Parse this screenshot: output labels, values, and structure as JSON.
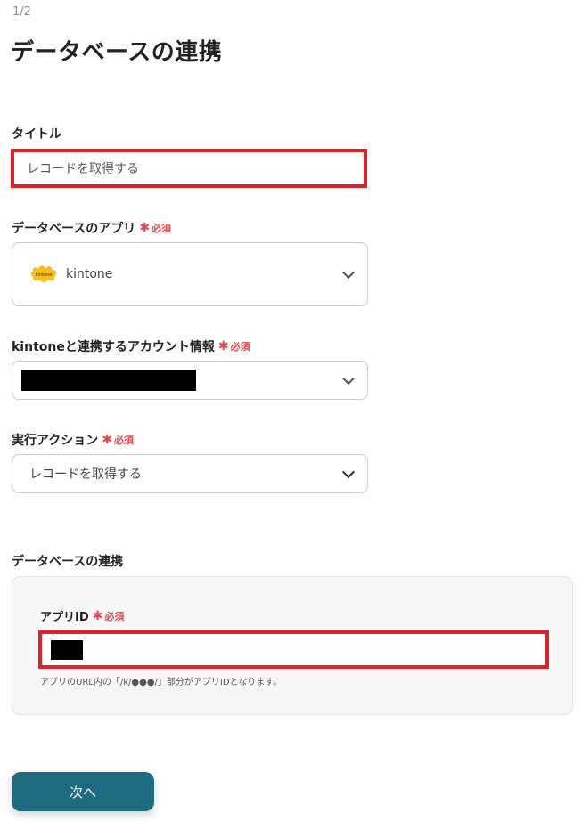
{
  "step": "1/2",
  "page_title": "データベースの連携",
  "required_star": "✱",
  "required_text": "必須",
  "fields": {
    "title": {
      "label": "タイトル",
      "value": "レコードを取得する"
    },
    "database_app": {
      "label": "データベースのアプリ",
      "value": "kintone",
      "logo_text": "kintone",
      "icon": "kintone-logo"
    },
    "account": {
      "label": "kintoneと連携するアカウント情報",
      "value": ""
    },
    "action": {
      "label": "実行アクション",
      "value": "レコードを取得する"
    }
  },
  "database_section": {
    "heading": "データベースの連携",
    "app_id": {
      "label": "アプリID",
      "value": "",
      "help": "アプリのURL内の「/k/●●●/」部分がアプリIDとなります。"
    }
  },
  "next_button": "次へ",
  "colors": {
    "accent": "#1e6b80",
    "required": "#e5464e",
    "highlight": "#e3202a",
    "kintone_logo": "#f5c21b"
  }
}
